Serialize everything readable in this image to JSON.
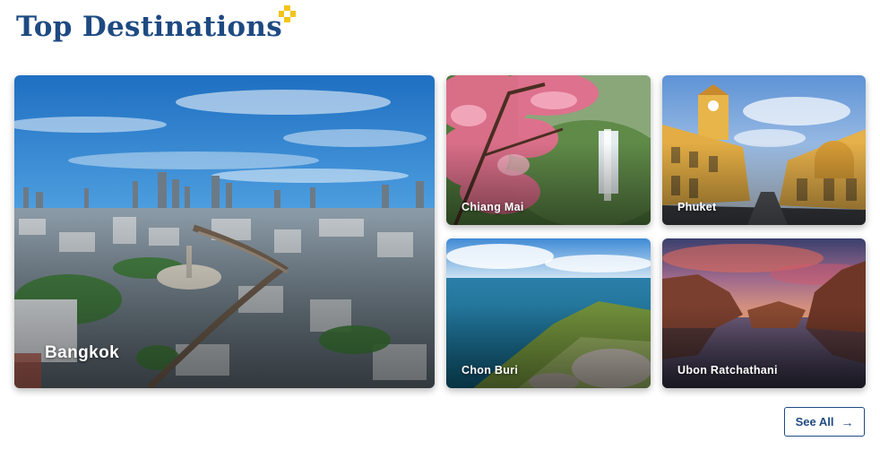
{
  "header": {
    "title": "Top Destinations",
    "decoration_icon": "sparkle-icon",
    "accent_color": "#f2c418"
  },
  "destinations": [
    {
      "name": "Bangkok"
    },
    {
      "name": "Chiang Mai"
    },
    {
      "name": "Phuket"
    },
    {
      "name": "Chon Buri"
    },
    {
      "name": "Ubon Ratchathani"
    }
  ],
  "actions": {
    "see_all_label": "See All",
    "see_all_icon": "arrow-right-icon"
  },
  "colors": {
    "brand": "#1e4a82",
    "text_on_image": "#ffffff"
  }
}
